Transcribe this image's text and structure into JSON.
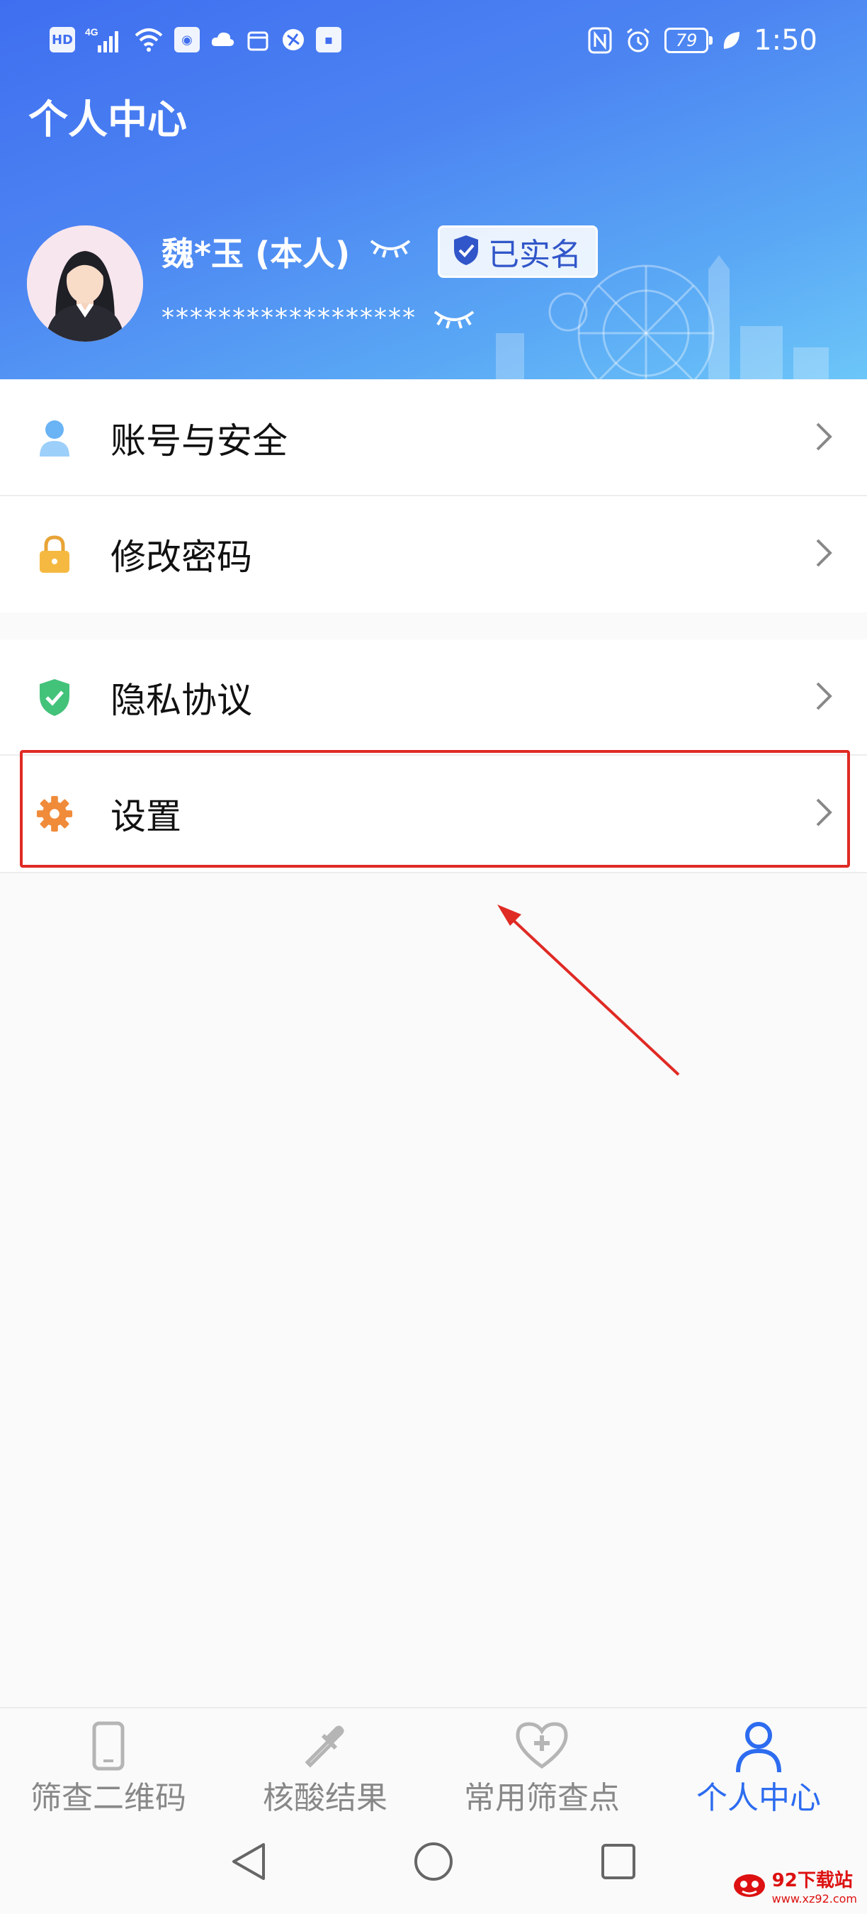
{
  "status_bar": {
    "network": "HD",
    "signal_type": "4G",
    "battery": "79",
    "time": "1:50"
  },
  "header": {
    "title": "个人中心",
    "user_name": "魏*玉 (本人)",
    "verified_label": "已实名",
    "masked_id": "******************"
  },
  "menu": [
    {
      "label": "账号与安全",
      "icon": "user-icon"
    },
    {
      "label": "修改密码",
      "icon": "lock-icon"
    },
    {
      "label": "隐私协议",
      "icon": "shield-check-icon"
    },
    {
      "label": "设置",
      "icon": "gear-icon"
    }
  ],
  "tabs": [
    {
      "label": "筛查二维码",
      "icon": "phone-icon",
      "active": false
    },
    {
      "label": "核酸结果",
      "icon": "dropper-icon",
      "active": false
    },
    {
      "label": "常用筛查点",
      "icon": "heart-plus-icon",
      "active": false
    },
    {
      "label": "个人中心",
      "icon": "person-icon",
      "active": true
    }
  ],
  "colors": {
    "accent": "#2d6cf0",
    "highlight": "#e02a24"
  },
  "watermark": {
    "title": "92下载站",
    "url": "www.xz92.com"
  }
}
